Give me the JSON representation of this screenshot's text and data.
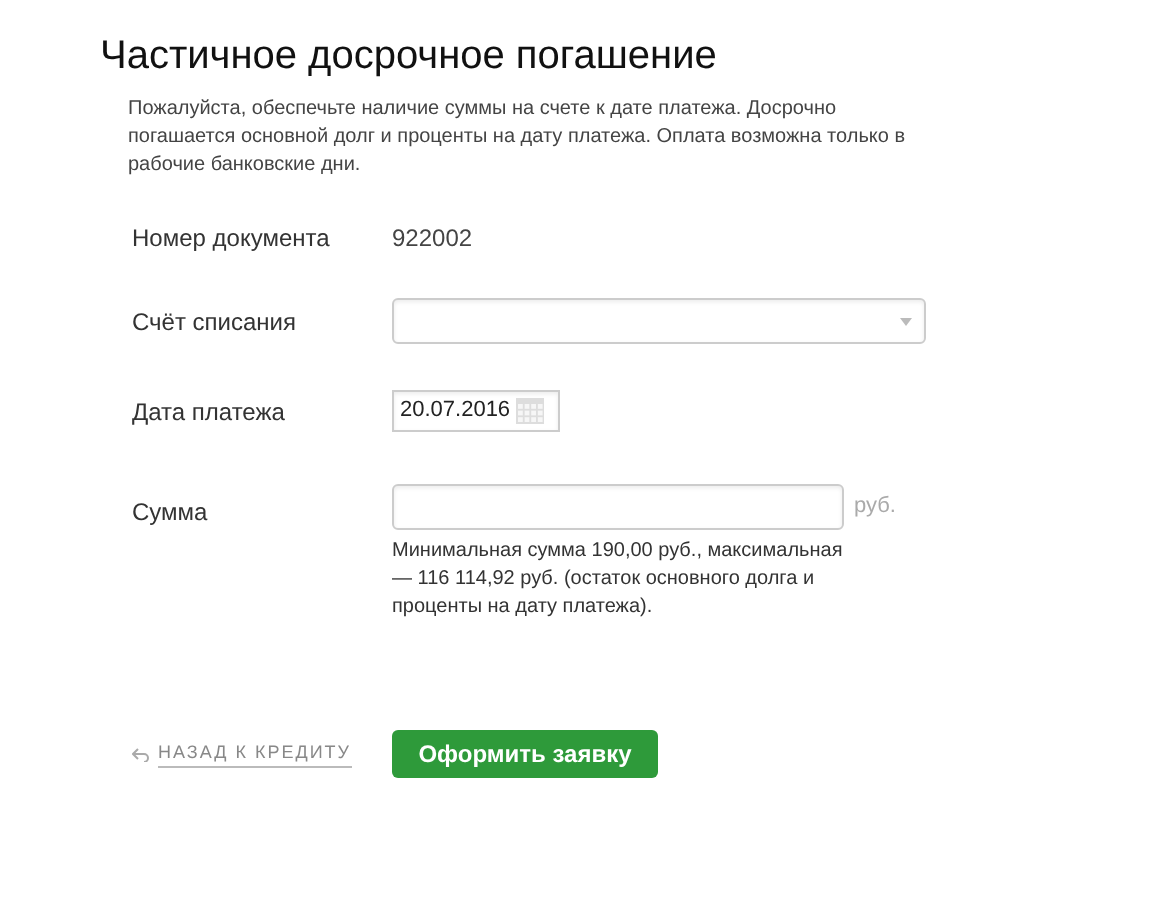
{
  "title": "Частичное досрочное погашение",
  "notice": "Пожалуйста, обеспечьте наличие суммы на счете к дате платежа. Досрочно погашается основной долг и проценты на дату платежа. Оплата возможна только в рабочие банковские дни.",
  "document": {
    "label": "Номер документа",
    "value": "922002"
  },
  "account": {
    "label": "Счёт списания"
  },
  "payment_date": {
    "label": "Дата платежа",
    "value": "20.07.2016"
  },
  "amount": {
    "label": "Сумма",
    "unit": "руб.",
    "hint": "Минимальная сумма 190,00 руб., максимальная — 116 114,92 руб. (остаток основного долга и проценты на дату платежа)."
  },
  "back_link": "НАЗАД К КРЕДИТУ",
  "submit_button": "Оформить заявку"
}
